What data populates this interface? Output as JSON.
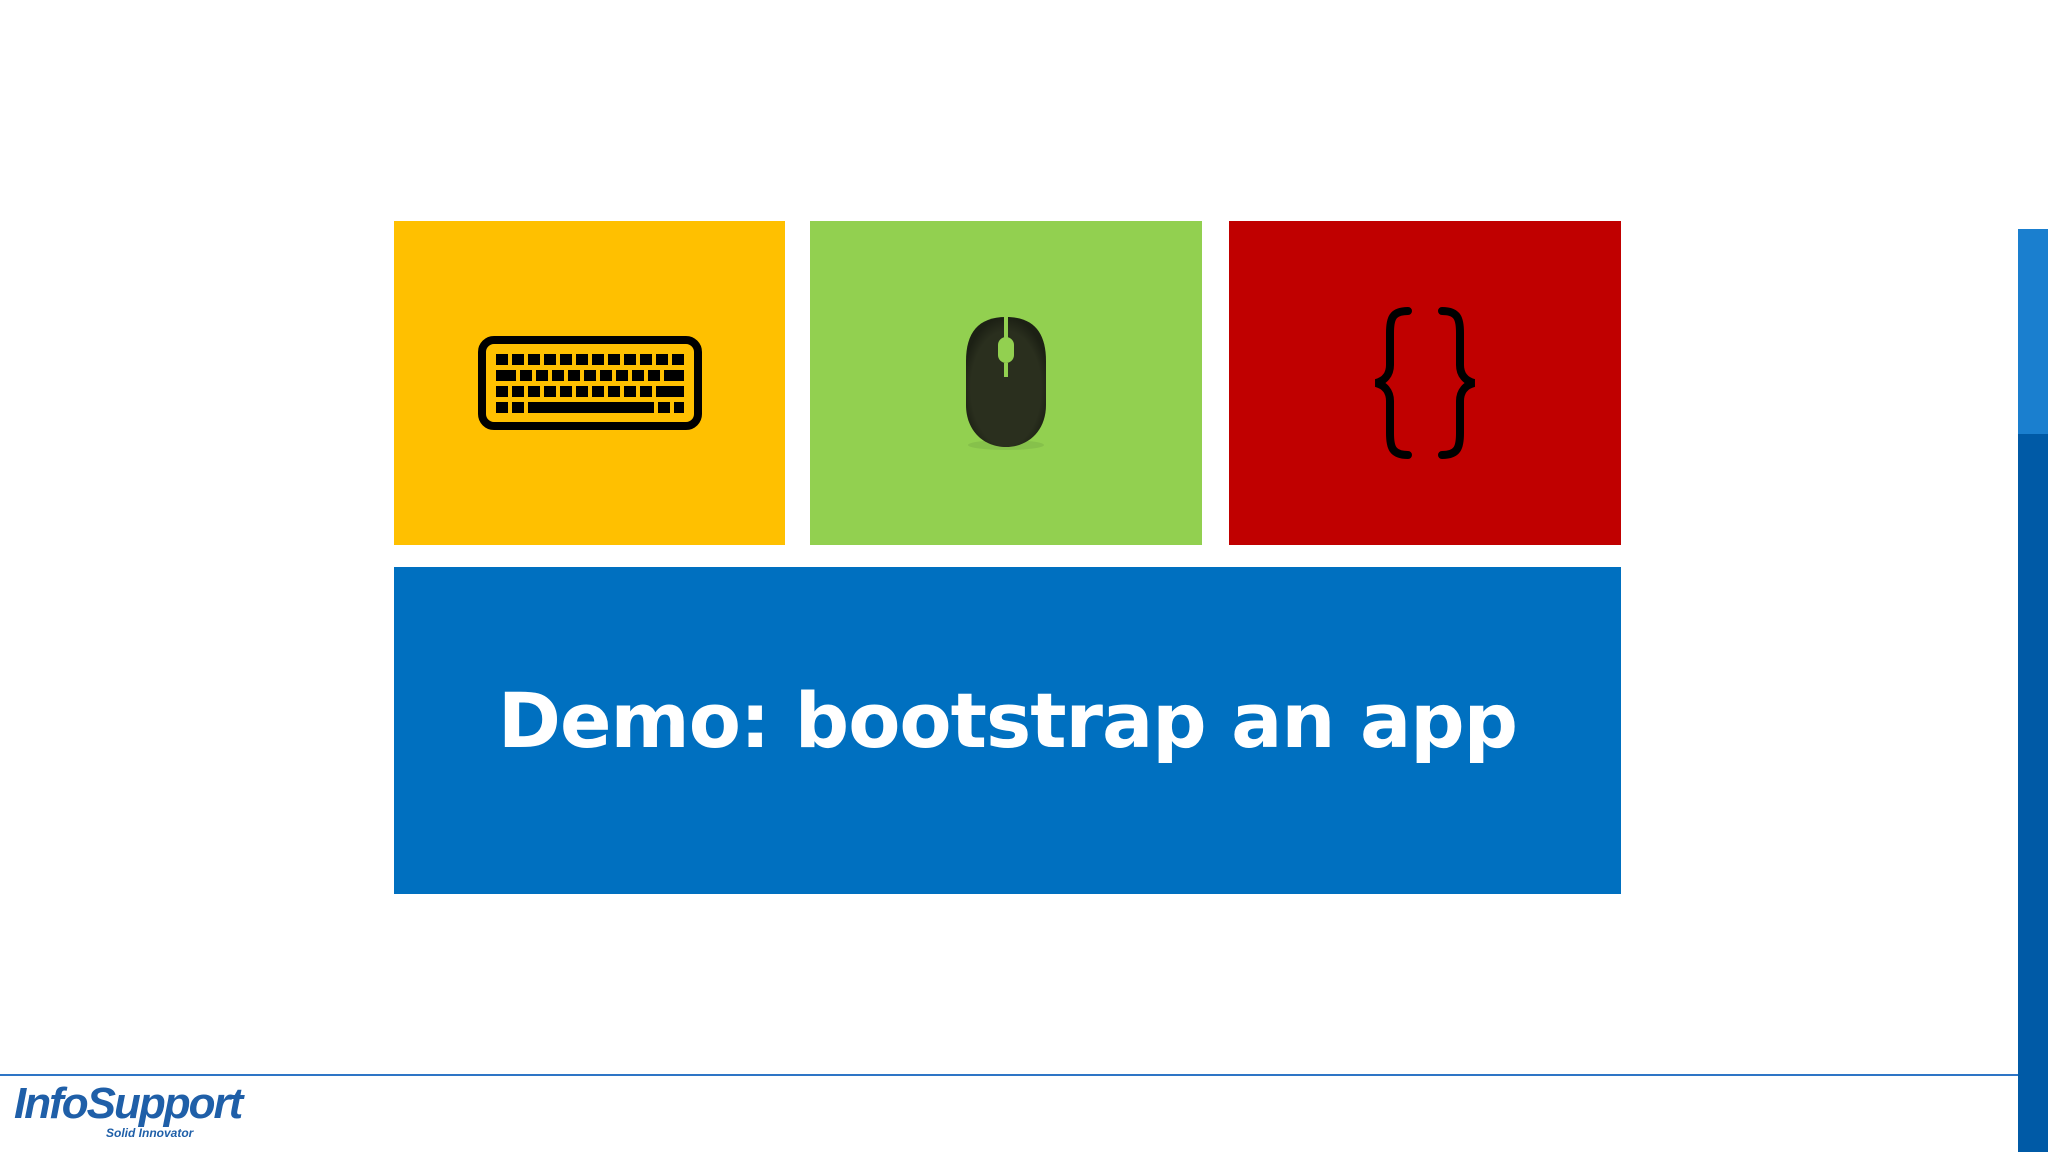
{
  "slide": {
    "title": "Demo: bootstrap an app"
  },
  "tiles": [
    {
      "name": "keyboard",
      "color": "#FFC000",
      "icon": "keyboard-icon"
    },
    {
      "name": "mouse",
      "color": "#92D050",
      "icon": "mouse-icon"
    },
    {
      "name": "code",
      "color": "#C00000",
      "icon": "curly-braces-icon"
    }
  ],
  "title_tile": {
    "color": "#0070C0"
  },
  "logo": {
    "name": "InfoSupport",
    "tagline": "Solid Innovator",
    "color": "#1f5fa8"
  },
  "accent_colors": {
    "footer_line": "#2e75c6",
    "right_bar": "#005aa6"
  }
}
